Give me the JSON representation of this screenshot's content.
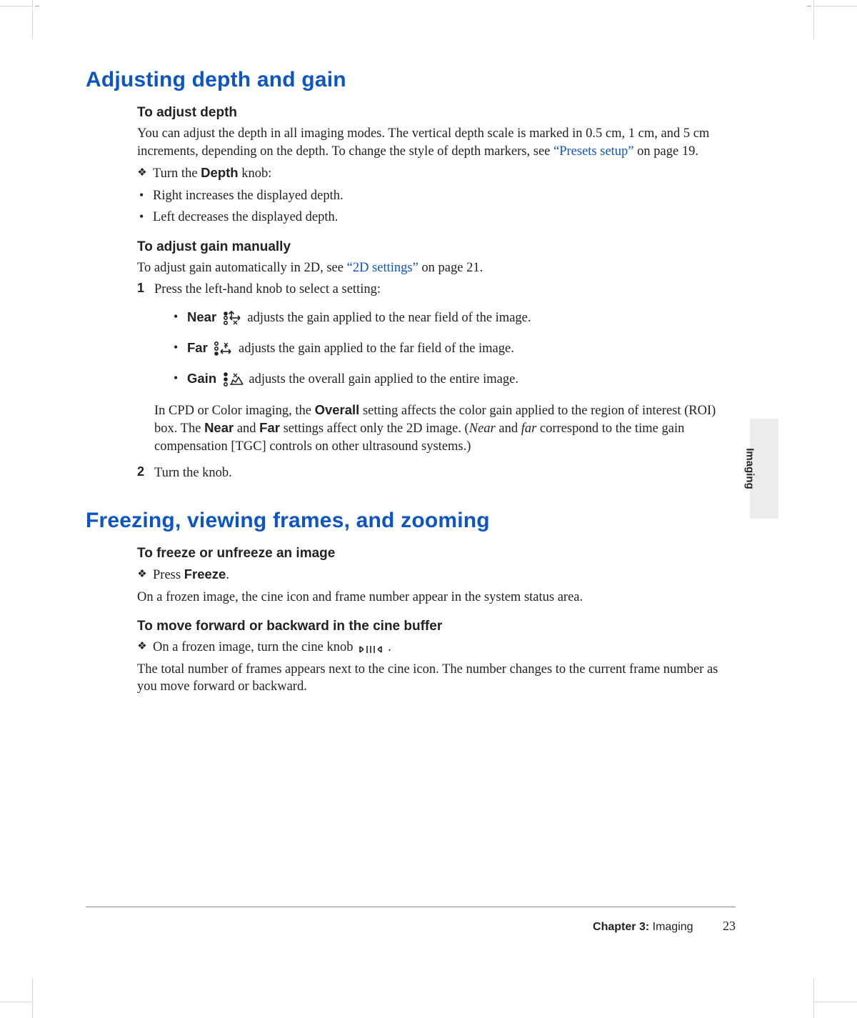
{
  "side_tab": "Imaging",
  "sec1": {
    "title": "Adjusting depth and gain",
    "h_depth": "To adjust depth",
    "p_depth_1": "You can adjust the depth in all imaging modes. The vertical depth scale is marked in 0.5 cm, 1 cm, and 5 cm increments, depending on the depth. To change the style of depth markers, see ",
    "p_depth_link": "“Presets setup”",
    "p_depth_2": " on page 19.",
    "turn_depth_pre": "Turn the ",
    "knob_depth": "Depth",
    "turn_depth_post": " knob:",
    "li_right": "Right increases the displayed depth.",
    "li_left": "Left decreases the displayed depth.",
    "h_gain": "To adjust gain manually",
    "p_gain_pre": "To adjust gain automatically in 2D, see ",
    "p_gain_link": "“2D settings”",
    "p_gain_post": " on page 21.",
    "step1": "Press the left-hand knob to select a setting:",
    "near_label": "Near",
    "near_text": " adjusts the gain applied to the near field of the image.",
    "far_label": "Far",
    "far_text": " adjusts the gain applied to the far field of the image.",
    "gain_label": "Gain",
    "gain_text": " adjusts the overall gain applied to the entire image.",
    "note_1a": "In CPD or Color imaging, the ",
    "note_overall": "Overall",
    "note_1b": " setting affects the color gain applied to the region of interest (ROI) box. The ",
    "note_near": "Near",
    "note_1c": " and ",
    "note_far": "Far",
    "note_1d": " settings affect only the 2D image. (",
    "note_near_i": "Near",
    "note_1e": " and ",
    "note_far_i": "far",
    "note_1f": " correspond to the time gain compensation [TGC] controls on other ultrasound systems.)",
    "step2": "Turn the knob."
  },
  "sec2": {
    "title": "Freezing, viewing frames, and zooming",
    "h_freeze": "To freeze or unfreeze an image",
    "freeze_pre": "Press ",
    "freeze_kw": "Freeze",
    "freeze_post": ".",
    "freeze_note": "On a frozen image, the cine icon and frame number appear in the system status area.",
    "h_cine": "To move forward or backward in the cine buffer",
    "cine_pre": "On a frozen image, turn the cine knob ",
    "cine_post": ".",
    "cine_note": "The total number of frames appears next to the cine icon. The number changes to the current frame number as you move forward or backward."
  },
  "footer": {
    "chapter": "Chapter 3:",
    "name": "Imaging",
    "page": "23"
  }
}
